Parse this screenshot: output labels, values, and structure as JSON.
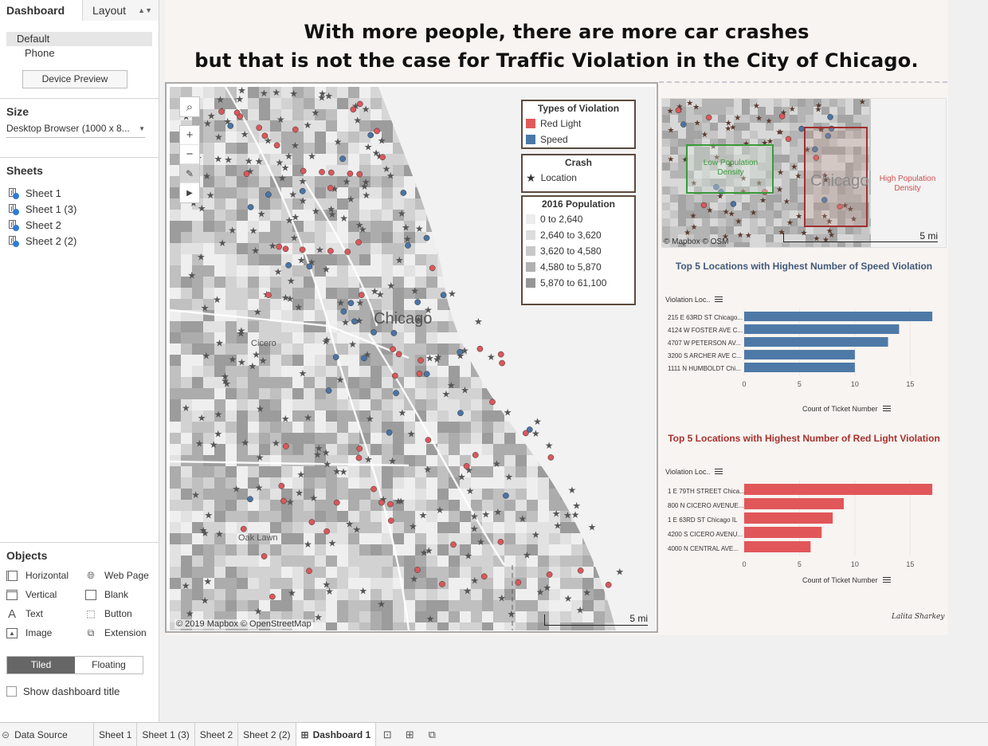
{
  "side_panel": {
    "tabs": {
      "dashboard": "Dashboard",
      "layout": "Layout"
    },
    "device": {
      "default": "Default",
      "phone": "Phone",
      "preview_button": "Device Preview"
    },
    "size": {
      "title": "Size",
      "value": "Desktop Browser (1000 x 8..."
    },
    "sheets": {
      "title": "Sheets",
      "items": [
        "Sheet 1",
        "Sheet 1 (3)",
        "Sheet 2",
        "Sheet 2 (2)"
      ]
    },
    "objects": {
      "title": "Objects",
      "items": [
        {
          "label": "Horizontal",
          "icon": "horizontal-icon"
        },
        {
          "label": "Web Page",
          "icon": "globe-icon"
        },
        {
          "label": "Vertical",
          "icon": "vertical-icon"
        },
        {
          "label": "Blank",
          "icon": "blank-icon"
        },
        {
          "label": "Text",
          "icon": "text-icon"
        },
        {
          "label": "Button",
          "icon": "button-icon"
        },
        {
          "label": "Image",
          "icon": "image-icon"
        },
        {
          "label": "Extension",
          "icon": "extension-icon"
        }
      ]
    },
    "layout_mode": {
      "tiled": "Tiled",
      "floating": "Floating",
      "active": "Tiled"
    },
    "show_title": "Show dashboard title"
  },
  "dashboard": {
    "headline": {
      "line1": "With more people, there are more car crashes",
      "line2": "but that is not the case for Traffic Violation in the City of Chicago."
    },
    "map": {
      "attribution": "© 2019 Mapbox © OpenStreetMap",
      "scale": "5 mi",
      "city_label": "Chicago",
      "towns": {
        "cicero": "Cicero",
        "oak_lawn": "Oak Lawn"
      },
      "legend_violation": {
        "title": "Types of Violation",
        "items": [
          {
            "label": "Red Light",
            "color": "#e05a5a"
          },
          {
            "label": "Speed",
            "color": "#4a78a8"
          }
        ]
      },
      "legend_crash": {
        "title": "Crash",
        "item": "Location"
      },
      "legend_population": {
        "title": "2016 Population",
        "items": [
          {
            "label": "0 to 2,640",
            "color": "#ececec"
          },
          {
            "label": "2,640 to 3,620",
            "color": "#dcdcdc"
          },
          {
            "label": "3,620 to 4,580",
            "color": "#c8c8c8"
          },
          {
            "label": "4,580 to 5,870",
            "color": "#b0b0b0"
          },
          {
            "label": "5,870 to 61,100",
            "color": "#959595"
          }
        ]
      }
    },
    "inset_map": {
      "low_label": "Low Population Density",
      "high_label": "High Population Density",
      "city_label": "Chicago",
      "attribution": "© Mapbox © OSM",
      "scale": "5 mi"
    },
    "signature": "Lalita Sharkey"
  },
  "chart_data": [
    {
      "type": "bar",
      "title": "Top 5 Locations with Highest Number of Speed Violation",
      "category_header": "Violation Loc..",
      "xlabel": "Count of Ticket Number",
      "categories": [
        "215 E 63RD ST Chicago...",
        "4124 W FOSTER AVE C...",
        "4707 W PETERSON AV...",
        "3200 S ARCHER AVE C...",
        "1111 N HUMBOLDT Chi..."
      ],
      "values": [
        17,
        14,
        13,
        10,
        10
      ],
      "xticks": [
        0,
        5,
        10,
        15
      ],
      "xlim": [
        0,
        18
      ],
      "color": "#4e79a7"
    },
    {
      "type": "bar",
      "title": "Top 5 Locations with Highest Number of Red Light Violation",
      "category_header": "Violation Loc..",
      "xlabel": "Count of Ticket Number",
      "categories": [
        "1 E 79TH STREET Chica...",
        "800 N CICERO AVENUE...",
        "1 E 63RD ST Chicago IL",
        "4200 S CICERO AVENU...",
        "4000 N CENTRAL AVE..."
      ],
      "values": [
        17,
        9,
        8,
        7,
        6
      ],
      "xticks": [
        0,
        5,
        10,
        15
      ],
      "xlim": [
        0,
        18
      ],
      "color": "#e15759"
    }
  ],
  "bottom_tabs": {
    "data_source": "Data Source",
    "sheets": [
      "Sheet 1",
      "Sheet 1 (3)",
      "Sheet 2",
      "Sheet 2 (2)"
    ],
    "active": "Dashboard 1",
    "icons": [
      "new-worksheet-icon",
      "new-dashboard-icon",
      "new-story-icon"
    ]
  }
}
